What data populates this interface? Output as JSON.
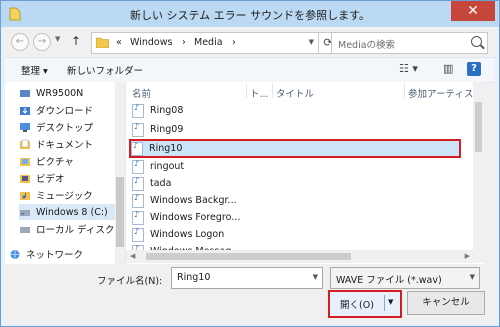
{
  "window": {
    "title": "新しい システム エラー サウンドを参照します。",
    "close": "✕"
  },
  "nav": {
    "back": "←",
    "forward": "→",
    "up": "↑",
    "address": [
      "«",
      "Windows",
      "›",
      "Media",
      "›"
    ],
    "search_placeholder": "Mediaの検索"
  },
  "toolbar": {
    "organize": "整理 ▾",
    "new_folder": "新しいフォルダー",
    "view": "☷ ▾",
    "pane": "▥",
    "help": "?"
  },
  "sidebar": {
    "items": [
      {
        "label": "WR9500N",
        "icon": "wrench-icon"
      },
      {
        "label": "ダウンロード",
        "icon": "download-folder-icon"
      },
      {
        "label": "デスクトップ",
        "icon": "desktop-icon"
      },
      {
        "label": "ドキュメント",
        "icon": "documents-icon"
      },
      {
        "label": "ピクチャ",
        "icon": "pictures-icon"
      },
      {
        "label": "ビデオ",
        "icon": "videos-icon"
      },
      {
        "label": "ミュージック",
        "icon": "music-icon"
      },
      {
        "label": "Windows 8 (C:)",
        "icon": "drive-icon"
      },
      {
        "label": "ローカル ディスク (D",
        "icon": "drive-icon"
      },
      {
        "label": "ネットワーク",
        "icon": "network-icon"
      }
    ]
  },
  "columns": {
    "name": "名前",
    "num": "ト...",
    "title": "タイトル",
    "artist": "参加アーティスト"
  },
  "files": [
    "Ring08",
    "Ring09",
    "Ring10",
    "ringout",
    "tada",
    "Windows Backgr...",
    "Windows Foregro...",
    "Windows Logon",
    "Windows Messag..."
  ],
  "footer": {
    "file_name_label": "ファイル名(N):",
    "file_name_value": "Ring10",
    "file_type": "WAVE ファイル (*.wav)",
    "open": "開く(O)",
    "cancel": "キャンセル"
  },
  "colors": {
    "accent": "#d31d24",
    "selection": "#cce4f7"
  }
}
